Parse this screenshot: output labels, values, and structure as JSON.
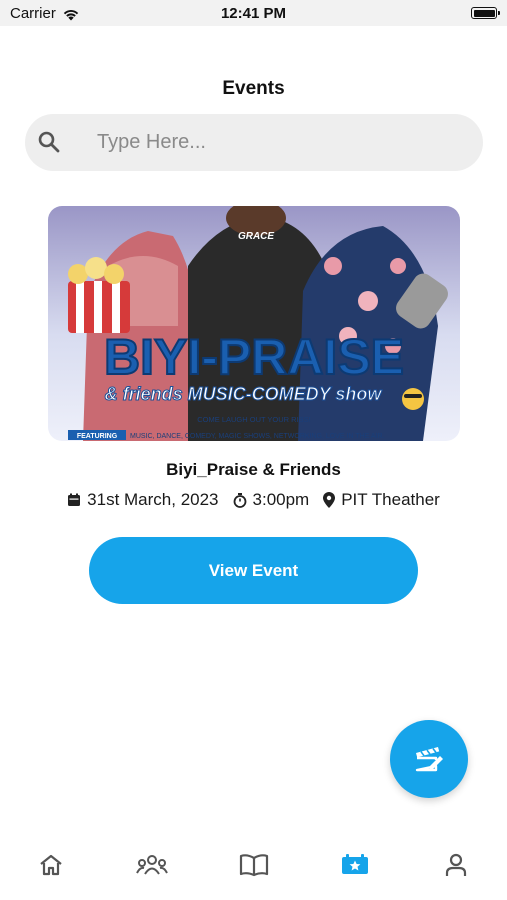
{
  "status_bar": {
    "carrier": "Carrier",
    "time": "12:41 PM"
  },
  "page": {
    "title": "Events"
  },
  "search": {
    "placeholder": "Type Here..."
  },
  "event": {
    "name": "Biyi_Praise & Friends",
    "date": "31st March, 2023",
    "time": "3:00pm",
    "venue": "PIT Theather",
    "view_label": "View Event",
    "poster": {
      "headline": "BIYI-PRAISE",
      "subline": "& friends MUSIC-COMEDY show",
      "tagline": "COME LAUGH OUT YOUR RIBS!",
      "featuring_label": "FEATURING",
      "featuring_text": "MUSIC, DANCE, COMEDY, MAGIC SHOWS, NETWORKING, LOVE IN THE AIR.",
      "shirt_text": "GRACE"
    }
  },
  "fab": {
    "icon": "clapperboard-edit-icon"
  },
  "tabs": [
    {
      "icon": "home-icon",
      "active": false
    },
    {
      "icon": "community-icon",
      "active": false
    },
    {
      "icon": "book-icon",
      "active": false
    },
    {
      "icon": "event-ticket-icon",
      "active": true
    },
    {
      "icon": "profile-icon",
      "active": false
    }
  ],
  "colors": {
    "accent": "#16a4ea",
    "tab_inactive": "#555555",
    "search_bg": "#eeeeee"
  }
}
